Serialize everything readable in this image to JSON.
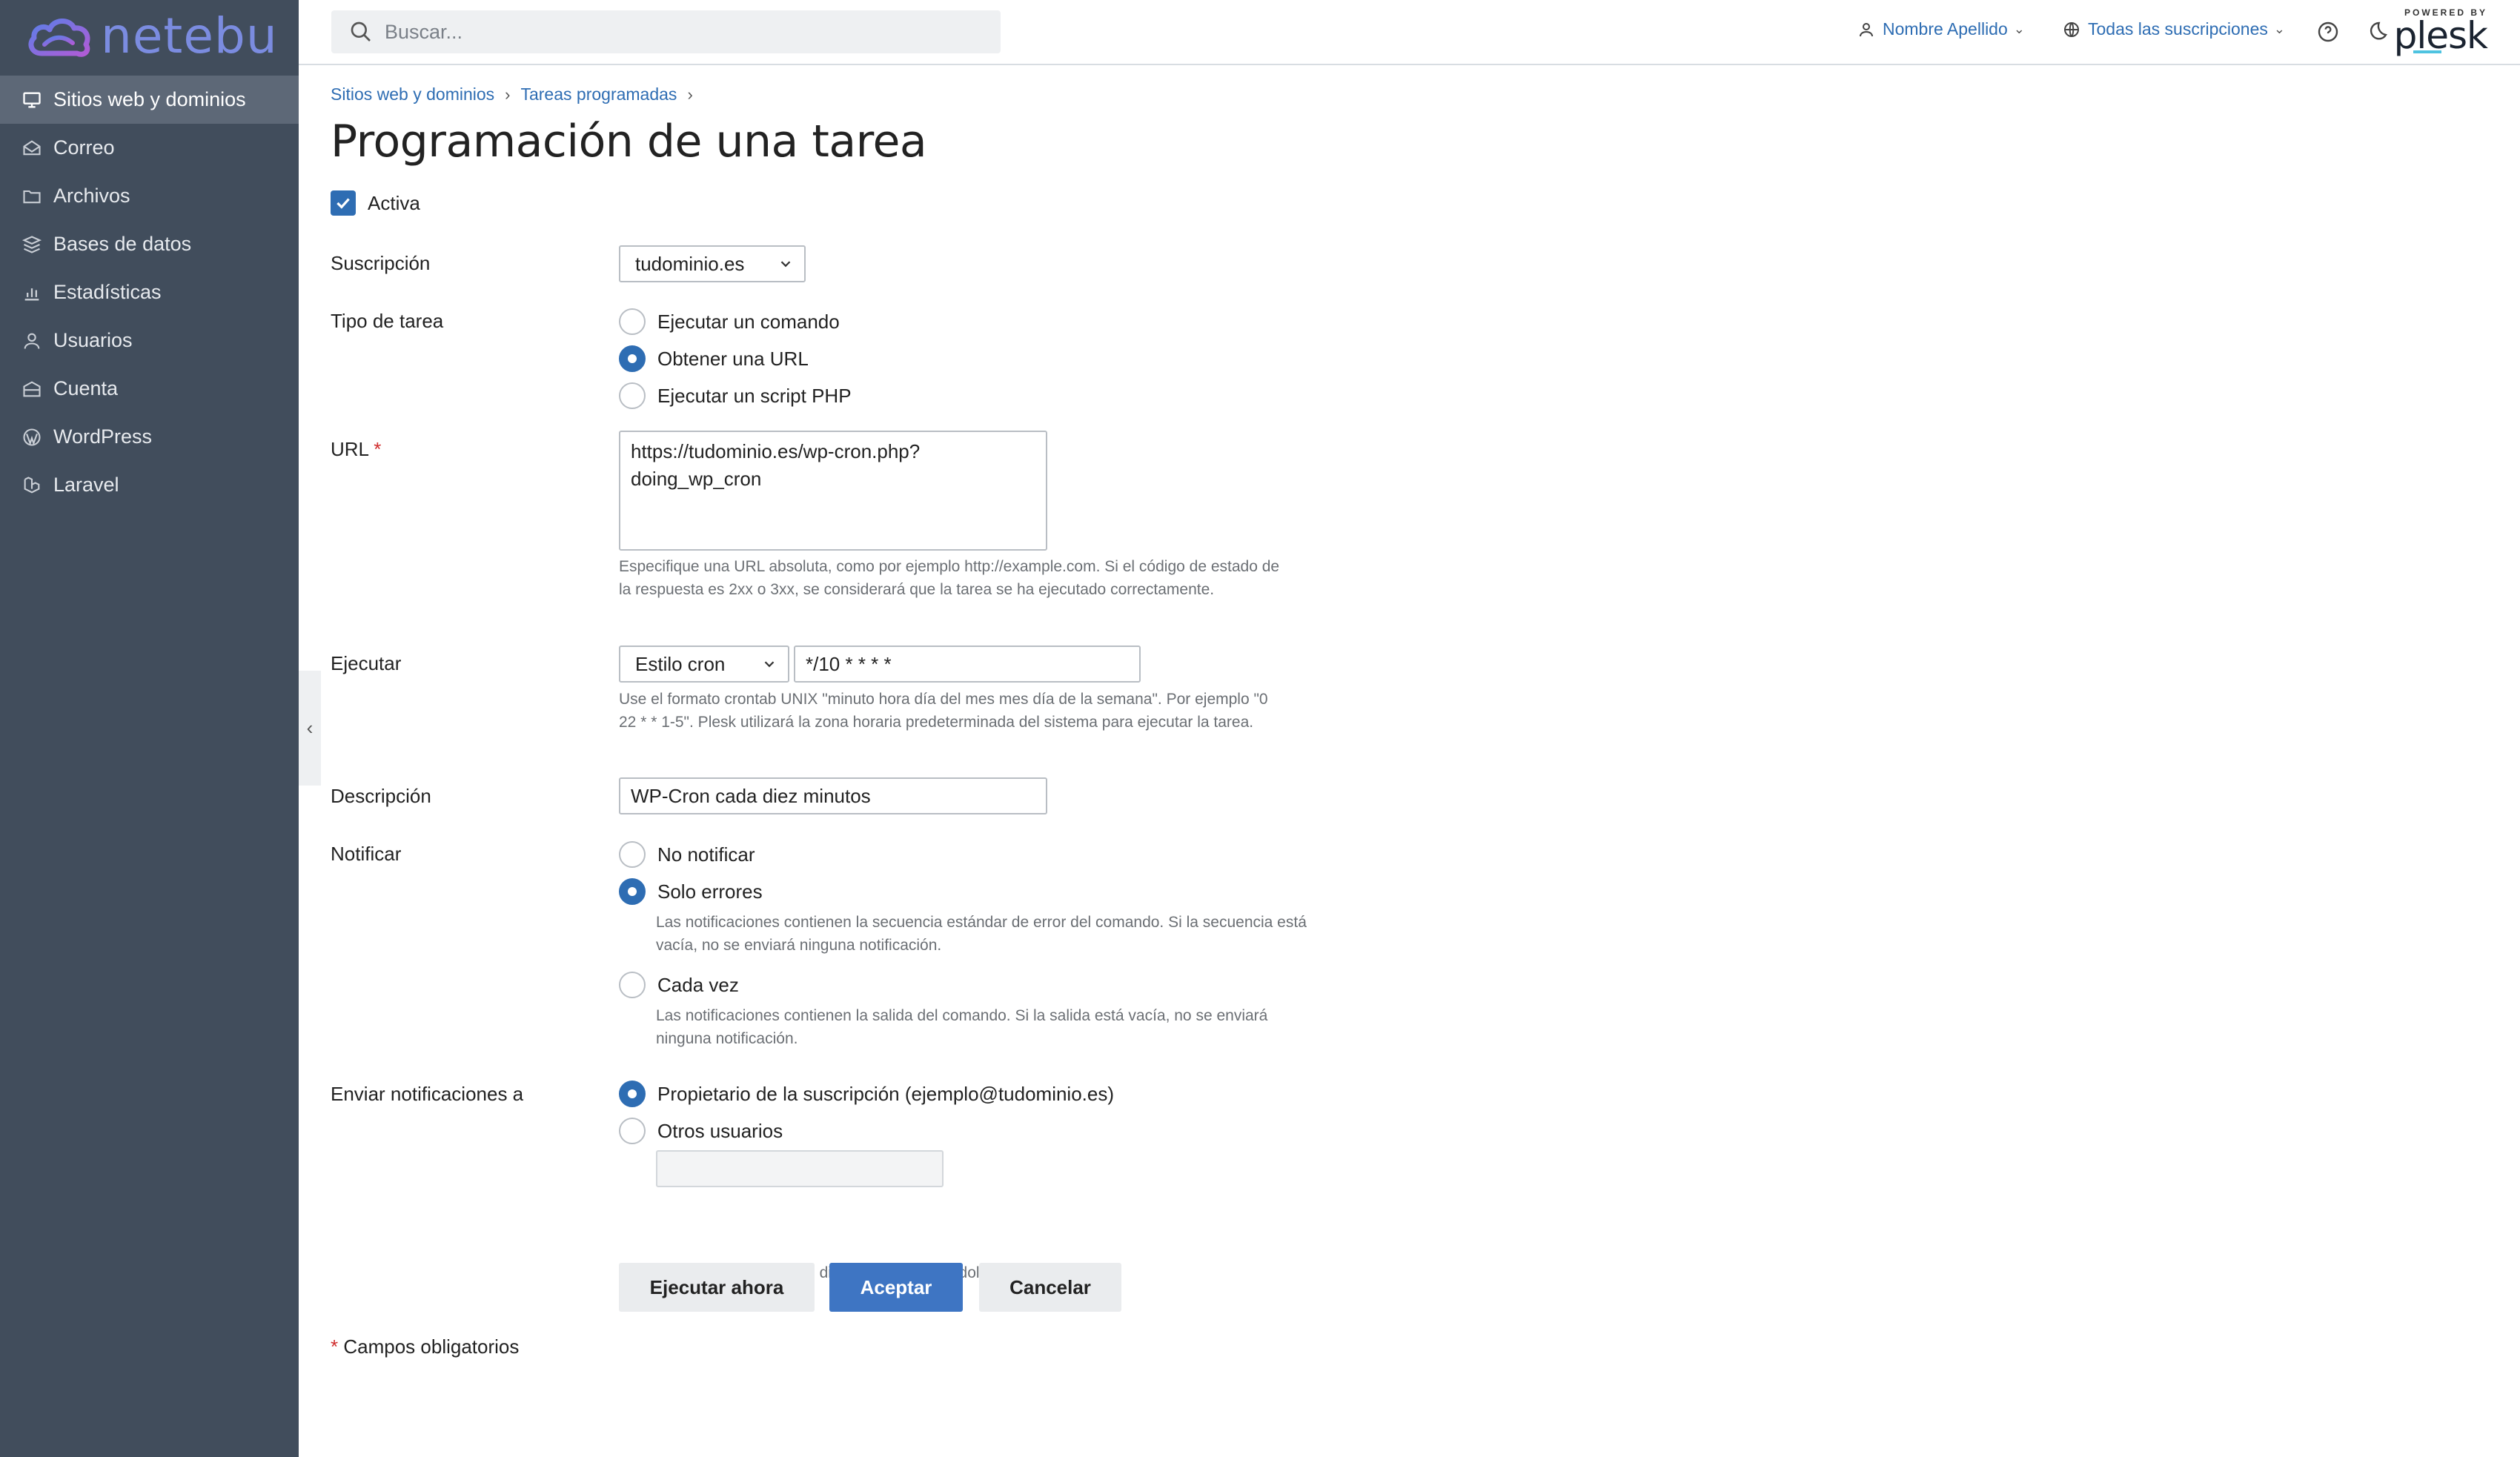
{
  "brand": {
    "name": "netebu"
  },
  "sidebar": {
    "items": [
      {
        "label": "Sitios web y dominios",
        "icon": "monitor-icon",
        "active": true
      },
      {
        "label": "Correo",
        "icon": "mail-icon"
      },
      {
        "label": "Archivos",
        "icon": "folder-icon"
      },
      {
        "label": "Bases de datos",
        "icon": "database-icon"
      },
      {
        "label": "Estadísticas",
        "icon": "stats-icon"
      },
      {
        "label": "Usuarios",
        "icon": "user-icon"
      },
      {
        "label": "Cuenta",
        "icon": "account-icon"
      },
      {
        "label": "WordPress",
        "icon": "wordpress-icon"
      },
      {
        "label": "Laravel",
        "icon": "laravel-icon"
      }
    ]
  },
  "topbar": {
    "search_placeholder": "Buscar...",
    "user": "Nombre Apellido",
    "subscriptions": "Todas las suscripciones",
    "powered_by": "POWERED BY",
    "plesk": "plesk"
  },
  "breadcrumbs": [
    "Sitios web y dominios",
    "Tareas programadas"
  ],
  "page_title": "Programación de una tarea",
  "form": {
    "active": {
      "label": "Activa",
      "checked": true
    },
    "subscription": {
      "label": "Suscripción",
      "value": "tudominio.es"
    },
    "task_type": {
      "label": "Tipo de tarea",
      "options": [
        "Ejecutar un comando",
        "Obtener una URL",
        "Ejecutar un script PHP"
      ],
      "selected": 1
    },
    "url": {
      "label": "URL",
      "required_mark": "*",
      "value": "https://tudominio.es/wp-cron.php?\ndoing_wp_cron",
      "hint": "Especifique una URL absoluta, como por ejemplo http://example.com. Si el código de estado de la respuesta es 2xx o 3xx, se considerará que la tarea se ha ejecutado correctamente."
    },
    "run": {
      "label": "Ejecutar",
      "style": "Estilo cron",
      "cron": "*/10 * * * *",
      "hint": "Use el formato crontab UNIX \"minuto hora día del mes mes día de la semana\". Por ejemplo \"0 22 * * 1-5\". Plesk utilizará la zona horaria predeterminada del sistema para ejecutar la tarea."
    },
    "description": {
      "label": "Descripción",
      "value": "WP-Cron cada diez minutos"
    },
    "notify": {
      "label": "Notificar",
      "options": [
        {
          "label": "No notificar",
          "hint": ""
        },
        {
          "label": "Solo errores",
          "hint": "Las notificaciones contienen la secuencia estándar de error del comando. Si la secuencia está vacía, no se enviará ninguna notificación."
        },
        {
          "label": "Cada vez",
          "hint": "Las notificaciones contienen la salida del comando. Si la salida está vacía, no se enviará ninguna notificación."
        }
      ],
      "selected": 1
    },
    "send_to": {
      "label": "Enviar notificaciones a",
      "options": [
        "Propietario de la suscripción (ejemplo@tudominio.es)",
        "Otros usuarios"
      ],
      "selected": 0,
      "others_value": "",
      "hint": "Puede introducir varias direcciones separándolas con comas."
    },
    "required_note": "Campos obligatorios",
    "required_mark": "*"
  },
  "buttons": {
    "run_now": "Ejecutar ahora",
    "ok": "Aceptar",
    "cancel": "Cancelar"
  },
  "colors": {
    "sidebar": "#414d5c",
    "accent": "#2e6db3",
    "primary_button": "#3e75c3"
  }
}
